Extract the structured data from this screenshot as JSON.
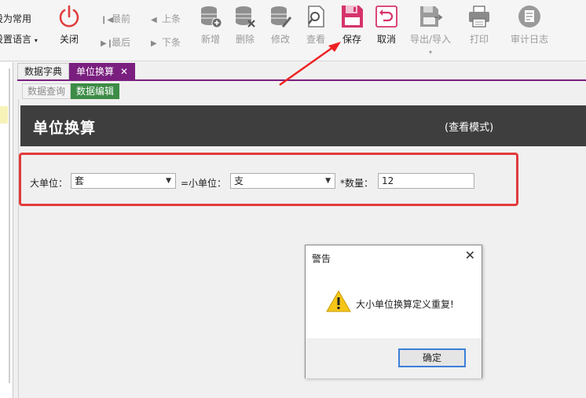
{
  "toolbar": {
    "left_menu": {
      "set_common": "设为常用",
      "set_language": "设置语言",
      "language_caret": "▾"
    },
    "close": "关闭",
    "nav": {
      "first": "最前",
      "prev": "上条",
      "last": "最后",
      "next": "下条"
    },
    "add": "新增",
    "delete": "删除",
    "modify": "修改",
    "view": "查看",
    "save": "保存",
    "cancel": "取消",
    "export_import": "导出/导入",
    "export_caret": "▾",
    "print": "打印",
    "audit_log": "审计日志"
  },
  "tabs": [
    {
      "label": "数据字典"
    },
    {
      "label": "单位换算",
      "close": "✕"
    }
  ],
  "subtabs": [
    {
      "label": "数据查询"
    },
    {
      "label": "数据编辑"
    }
  ],
  "header": {
    "title": "单位换算",
    "mode": "(查看模式)"
  },
  "form": {
    "big_unit_label": "大单位：",
    "big_unit_value": "套",
    "small_unit_label": "=小单位：",
    "small_unit_value": "支",
    "qty_label": "*数量：",
    "qty_value": "12",
    "dropdown_caret": "▼"
  },
  "dialog": {
    "title": "警告",
    "close": "✕",
    "message": "大小单位换算定义重复!",
    "ok": "确定"
  },
  "colors": {
    "accent": "#7a1f7f",
    "green_tab": "#3d8c46",
    "save_pink": "#d6336c",
    "red_box": "#e23b3b",
    "header_bg": "#3e3e3e"
  }
}
